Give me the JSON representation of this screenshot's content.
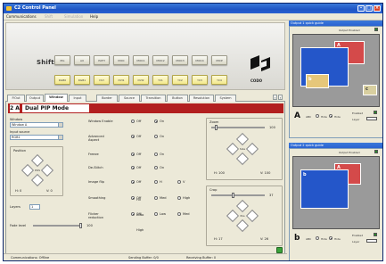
{
  "window": {
    "title": "C2 Control Panel"
  },
  "menu": {
    "communications": "Communications",
    "item2": "Shift",
    "item3": "Simulation",
    "help": "Help"
  },
  "keys": {
    "shift_label": "Shift",
    "row1": [
      "PIG",
      "A0",
      "PATH",
      "MIXC",
      "MIXC1",
      "MIXC2",
      "MIXC3",
      "MIXC4",
      "MIXP"
    ],
    "row2": [
      "RGB0",
      "RGB1",
      "DVI",
      "DVI1",
      "DVI2",
      "YC1",
      "YC2",
      "YC3",
      "YC4"
    ],
    "logo_text": "CODO"
  },
  "tabs": [
    "P.Out",
    "Output",
    "Window",
    "Input",
    "Border",
    "Source",
    "Transition",
    "Button",
    "Resolution",
    "System"
  ],
  "mode": {
    "letter": "2 A",
    "name": "Dual PIP Mode"
  },
  "left_fields": {
    "window_label": "Window",
    "window_value": "Window A",
    "input_label": "Input source",
    "input_value": "RGB1",
    "position_label": "Position",
    "pos_center": "POS",
    "pos_x": "H: 0",
    "pos_y": "V: 0",
    "layer_label": "Layers",
    "layer_value": "1",
    "fade_label": "Fade level",
    "fade_value": "100"
  },
  "options": [
    {
      "label": "Window Enable",
      "opts": [
        "Off",
        "On"
      ],
      "sel": 1
    },
    {
      "label": "Advanced Aspect",
      "opts": [
        "Off",
        "On"
      ],
      "sel": 0
    },
    {
      "label": "Freeze",
      "opts": [
        "Off",
        "On"
      ],
      "sel": 0
    },
    {
      "label": "De-Stitch",
      "opts": [
        "Off",
        "On"
      ],
      "sel": 0
    },
    {
      "label": "Image flip",
      "opts": [
        "Off",
        "H",
        "V"
      ],
      "sel": 0
    },
    {
      "label": "Smoothing",
      "opts": [
        "Off",
        "Med",
        "High"
      ],
      "sel": 0
    },
    {
      "label": "Flicker reduction",
      "opts": [
        "Off",
        "Low",
        "Med"
      ],
      "sel": 0
    }
  ],
  "extra_opts": {
    "image_flip_hv": "HV",
    "smoothing_auto": "Auto",
    "flicker_high": "High"
  },
  "zoom": {
    "label": "Zoom",
    "value": "100",
    "center": "Size",
    "h": "H: 100",
    "v": "V: 100"
  },
  "crop": {
    "label": "Crop",
    "value": "37",
    "center": "Pos",
    "h": "H: 17",
    "v": "V: 26"
  },
  "status": {
    "comm": "Communications: Offline",
    "sending": "Sending Buffer: 0/0",
    "receiving": "Receiving Buffer: 0"
  },
  "guide1": {
    "title": "Output 1 quick guide",
    "subtitle": "Output Enabled",
    "letter": "A",
    "abc_label": "ABC",
    "radio1": "Hide",
    "radio2": "Hide",
    "enabled_label": "Enabled",
    "layer_label": "Layer",
    "win_a": "A",
    "win_b": "b",
    "win_c": "c"
  },
  "guide2": {
    "title": "Output 2 quick guide",
    "subtitle": "Output Enabled",
    "letter": "b",
    "abc_label": "ABC",
    "radio1": "Hide",
    "radio2": "Hide",
    "enabled_label": "Enabled",
    "layer_label": "Layer",
    "win_a": "A",
    "win_b": "b"
  },
  "colors": {
    "title_blue": "#2a62d2",
    "mode_red": "#b21f1f",
    "win_blue": "#2456c9",
    "win_red": "#d44a4a",
    "win_yellow": "#e6c77a"
  }
}
